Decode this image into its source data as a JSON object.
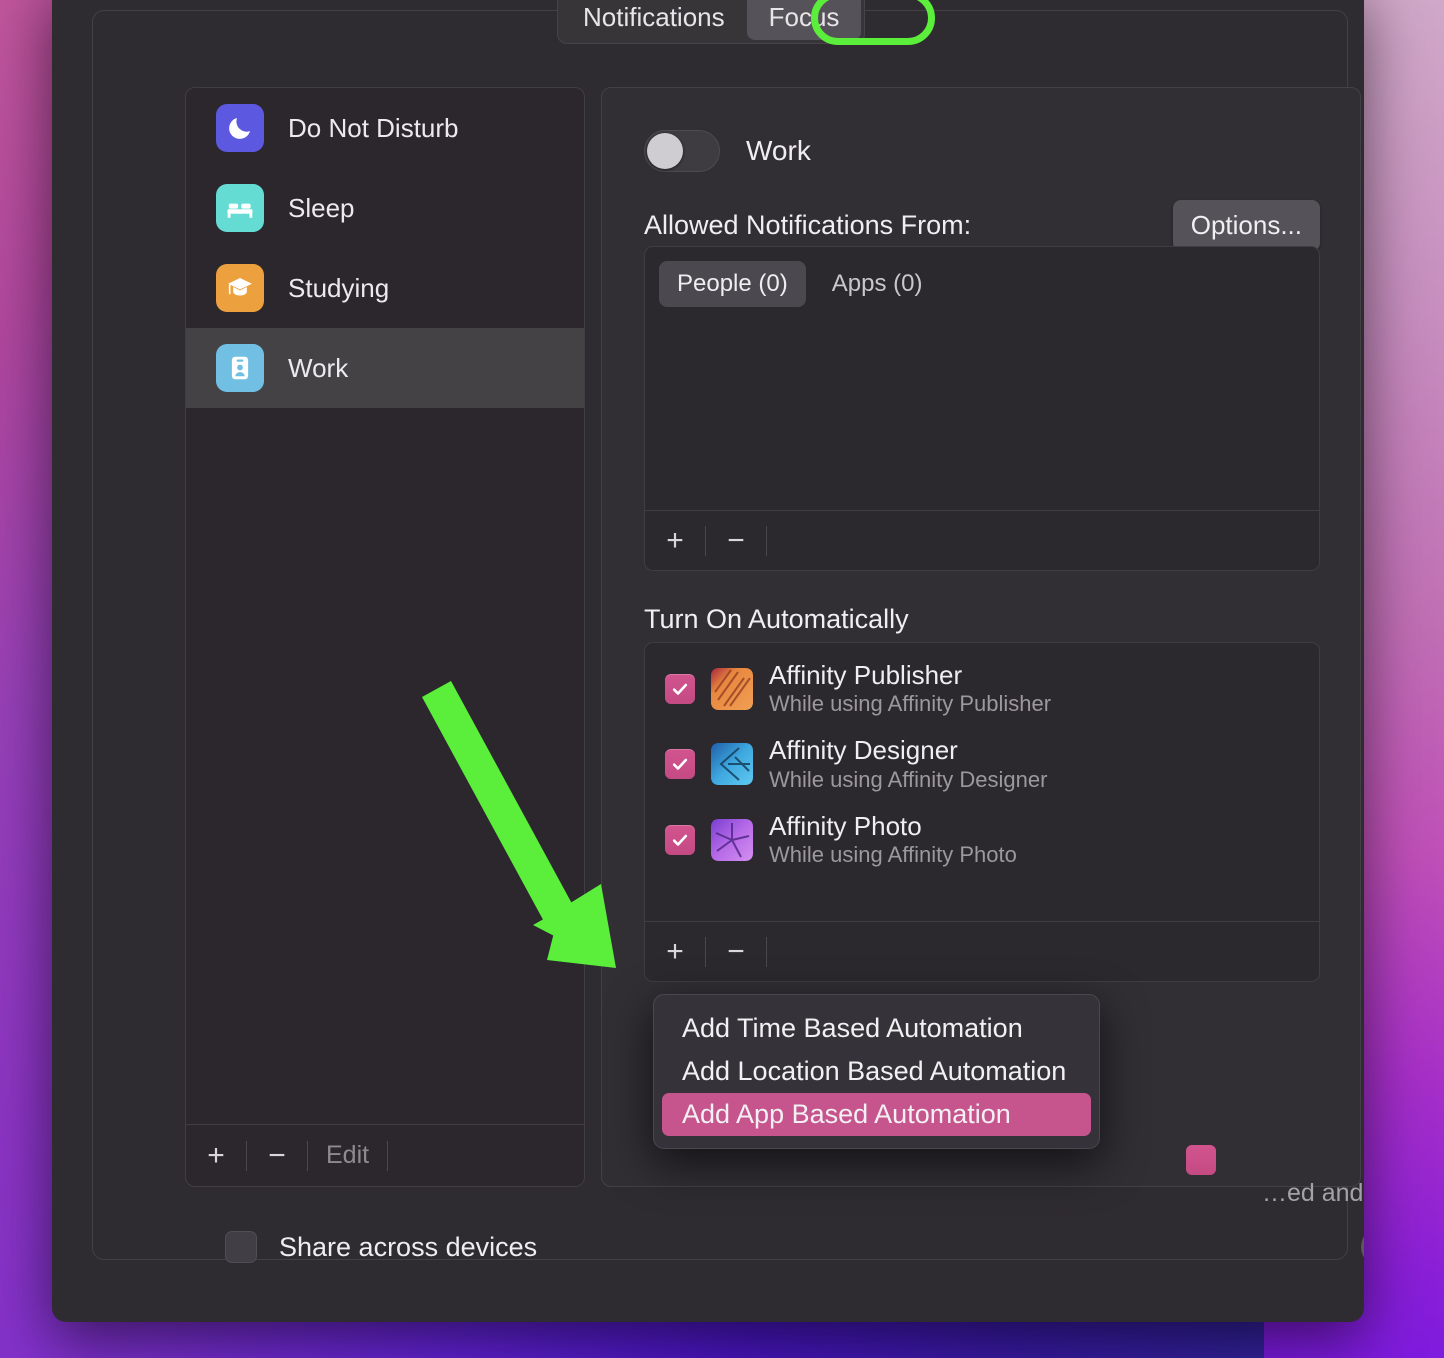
{
  "window": {
    "tabs": [
      {
        "label": "Notifications",
        "active": false
      },
      {
        "label": "Focus",
        "active": true
      }
    ]
  },
  "sidebar": {
    "items": [
      {
        "label": "Do Not Disturb",
        "icon": "moon-icon",
        "icon_color": "#5d58e0",
        "selected": false
      },
      {
        "label": "Sleep",
        "icon": "bed-icon",
        "icon_color": "#64dcd4",
        "selected": false
      },
      {
        "label": "Studying",
        "icon": "graduation-cap-icon",
        "icon_color": "#eda13e",
        "selected": false
      },
      {
        "label": "Work",
        "icon": "id-badge-icon",
        "icon_color": "#71c0e3",
        "selected": true
      }
    ],
    "toolbar": {
      "add_label": "+",
      "remove_label": "−",
      "edit_label": "Edit"
    }
  },
  "detail": {
    "focus_name": "Work",
    "toggle_on": false,
    "allowed_label": "Allowed Notifications From:",
    "options_button": "Options...",
    "allowed_tabs": [
      {
        "label": "People (0)",
        "active": true
      },
      {
        "label": "Apps (0)",
        "active": false
      }
    ],
    "allowed_toolbar": {
      "add_label": "+",
      "remove_label": "−"
    },
    "auto_title": "Turn On Automatically",
    "auto_items": [
      {
        "name": "Affinity Publisher",
        "subtitle": "While using Affinity Publisher",
        "checked": true,
        "icon": "affinity-publisher-icon"
      },
      {
        "name": "Affinity Designer",
        "subtitle": "While using Affinity Designer",
        "checked": true,
        "icon": "affinity-designer-icon"
      },
      {
        "name": "Affinity Photo",
        "subtitle": "While using Affinity Photo",
        "checked": true,
        "icon": "affinity-photo-icon"
      }
    ],
    "auto_toolbar": {
      "add_label": "+",
      "remove_label": "−"
    },
    "description": "…ed and allow …ing is important."
  },
  "popup_menu": {
    "items": [
      {
        "label": "Add Time Based Automation",
        "highlighted": false
      },
      {
        "label": "Add Location Based Automation",
        "highlighted": false
      },
      {
        "label": "Add App Based Automation",
        "highlighted": true
      }
    ]
  },
  "footer": {
    "share_label": "Share across devices",
    "share_checked": false,
    "help_label": "?"
  },
  "annotations": {
    "highlight_color": "#5bee3a",
    "arrow_color": "#5bee3a",
    "highlighted_tab": "Focus"
  }
}
